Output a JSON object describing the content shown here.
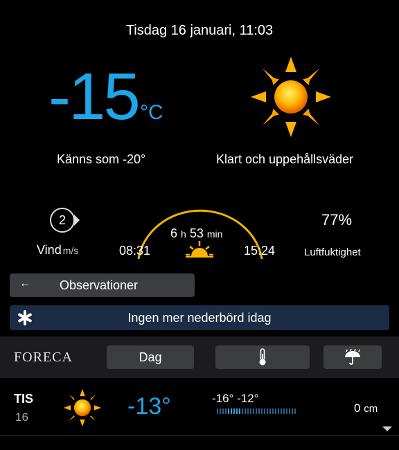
{
  "header": {
    "datetime": "Tisdag 16 januari, 11:03"
  },
  "current": {
    "temperature": "-15",
    "unit": "°C",
    "feels_like": "Känns som -20°",
    "condition": "Klart och uppehållsväder",
    "condition_icon": "sun-icon"
  },
  "wind": {
    "speed": "2",
    "label": "Vind",
    "unit": "m/s"
  },
  "sun": {
    "sunrise": "08:31",
    "sunset": "15:24",
    "day_hours": "6",
    "h": "h",
    "day_minutes": "53",
    "min": "min"
  },
  "humidity": {
    "value": "77%",
    "label": "Luftfuktighet"
  },
  "observations": {
    "label": "Observationer"
  },
  "precipitation": {
    "label": "Ingen mer nederbörd idag",
    "icon": "snowflake-icon"
  },
  "toolbar": {
    "logo": "FORECA",
    "day_button": "Dag",
    "thermo_icon": "thermometer-icon",
    "umbrella_icon": "umbrella-icon"
  },
  "forecast": [
    {
      "day": "TIS",
      "date": "16",
      "icon": "sun-icon",
      "temp": "-13°",
      "range": "-16° -12°",
      "precip": "0",
      "precip_unit": "cm"
    }
  ],
  "colors": {
    "accent": "#1fa6e8",
    "button": "#3b3d40",
    "precip_bar": "#1b2c45",
    "toolbar": "#1c1c1e"
  }
}
